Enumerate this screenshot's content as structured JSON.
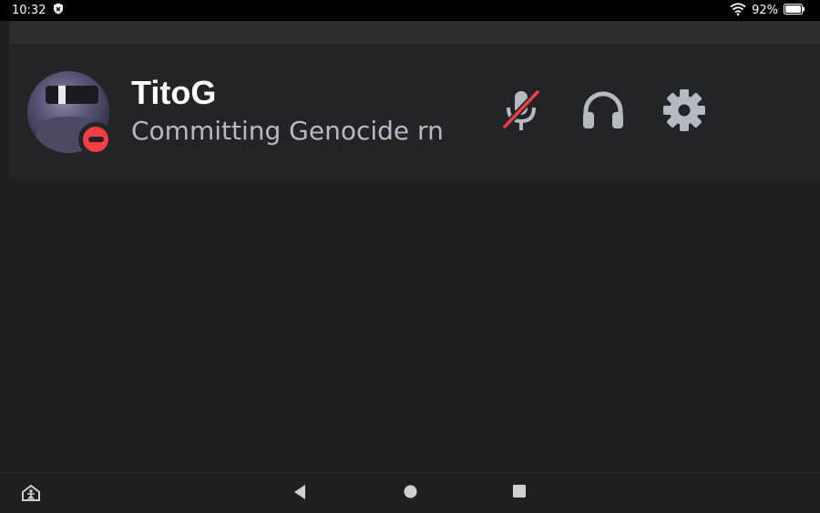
{
  "status_bar": {
    "time": "10:32",
    "battery": "92%",
    "icons": [
      "shield-icon",
      "wifi-icon",
      "battery-icon"
    ]
  },
  "profile": {
    "username": "TitoG",
    "custom_status": "Committing Genocide rn",
    "presence": "do-not-disturb",
    "presence_color": "#f23f43"
  },
  "controls": {
    "icons": [
      "microphone-muted-icon",
      "headset-icon",
      "settings-gear-icon"
    ],
    "mute_color": "#f23f43"
  },
  "nav": {
    "icons": [
      "accessibility-home-icon",
      "back-triangle-icon",
      "home-circle-icon",
      "recents-square-icon"
    ]
  }
}
